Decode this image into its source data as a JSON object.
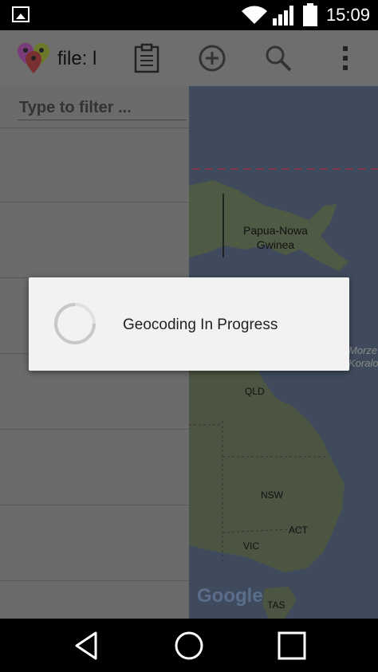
{
  "status_bar": {
    "time": "15:09"
  },
  "app_bar": {
    "title": "file: l"
  },
  "filter": {
    "placeholder": "Type to filter ..."
  },
  "map": {
    "labels": {
      "papua": "Papua-Nowa\nGwinea",
      "morze": "Morze\nKoralow",
      "qld": "QLD",
      "nsw": "NSW",
      "act": "ACT",
      "vic": "VIC",
      "tas": "TAS",
      "google": "Google"
    }
  },
  "dialog": {
    "message": "Geocoding In Progress"
  },
  "colors": {
    "scrim": "#6b6b6b",
    "dialog_bg": "#f2f2f2",
    "spinner": "#c8c8c8"
  }
}
